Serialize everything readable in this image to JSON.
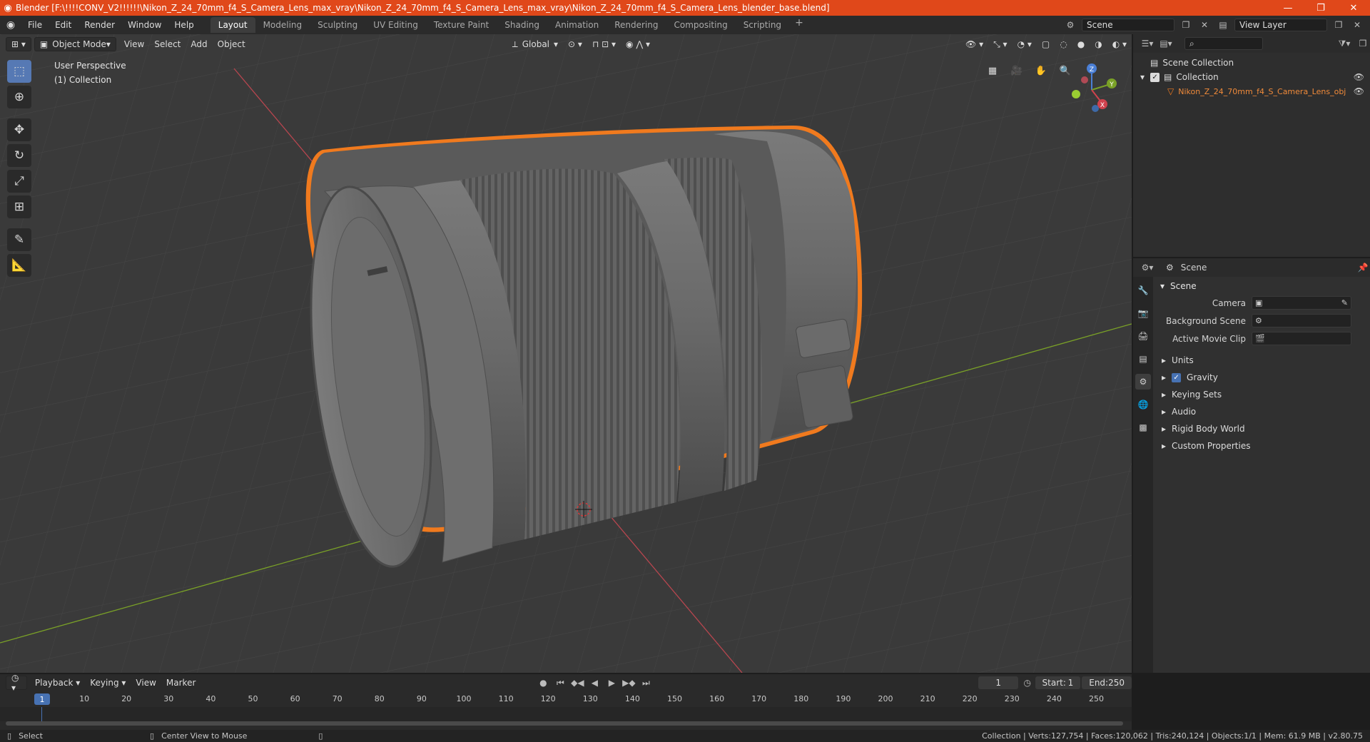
{
  "window": {
    "title": "Blender [F:\\!!!!CONV_V2!!!!!!\\Nikon_Z_24_70mm_f4_S_Camera_Lens_max_vray\\Nikon_Z_24_70mm_f4_S_Camera_Lens_max_vray\\Nikon_Z_24_70mm_f4_S_Camera_Lens_blender_base.blend]",
    "minimize": "—",
    "maximize": "❐",
    "close": "✕"
  },
  "menu": [
    "File",
    "Edit",
    "Render",
    "Window",
    "Help"
  ],
  "workspaces": [
    "Layout",
    "Modeling",
    "Sculpting",
    "UV Editing",
    "Texture Paint",
    "Shading",
    "Animation",
    "Rendering",
    "Compositing",
    "Scripting"
  ],
  "active_workspace": "Layout",
  "scene_field": "Scene",
  "view_layer_field": "View Layer",
  "viewport": {
    "mode": "Object Mode",
    "menus": [
      "View",
      "Select",
      "Add",
      "Object"
    ],
    "transform_orientation": "Global",
    "info_line1": "User Perspective",
    "info_line2": "(1) Collection"
  },
  "outliner": {
    "rows": [
      {
        "label": "Scene Collection"
      },
      {
        "label": "Collection"
      },
      {
        "label": "Nikon_Z_24_70mm_f4_S_Camera_Lens_obj"
      }
    ]
  },
  "properties": {
    "header": "Scene",
    "panel": "Scene",
    "fields": [
      {
        "label": "Camera"
      },
      {
        "label": "Background Scene"
      },
      {
        "label": "Active Movie Clip"
      }
    ],
    "subpanels": [
      "Units",
      "Gravity",
      "Keying Sets",
      "Audio",
      "Rigid Body World",
      "Custom Properties"
    ]
  },
  "timeline": {
    "menus": [
      "Playback",
      "Keying",
      "View",
      "Marker"
    ],
    "current_frame": "1",
    "start_label": "Start:",
    "start": "1",
    "end_label": "End:",
    "end": "250",
    "ruler": [
      "1",
      "10",
      "20",
      "30",
      "40",
      "50",
      "60",
      "70",
      "80",
      "90",
      "100",
      "110",
      "120",
      "130",
      "140",
      "150",
      "160",
      "170",
      "180",
      "190",
      "200",
      "210",
      "220",
      "230",
      "240",
      "250"
    ]
  },
  "status": {
    "left": "Select",
    "middle": "Center View to Mouse",
    "right": "Collection | Verts:127,754 | Faces:120,062 | Tris:240,124 | Objects:1/1 | Mem: 61.9 MB | v2.80.75"
  },
  "colors": {
    "title_bar": "#e0481a",
    "selection_outline": "#f07a1e",
    "x_axis": "#b8464f",
    "y_axis": "#7aa127",
    "active_blue": "#4772b3"
  }
}
